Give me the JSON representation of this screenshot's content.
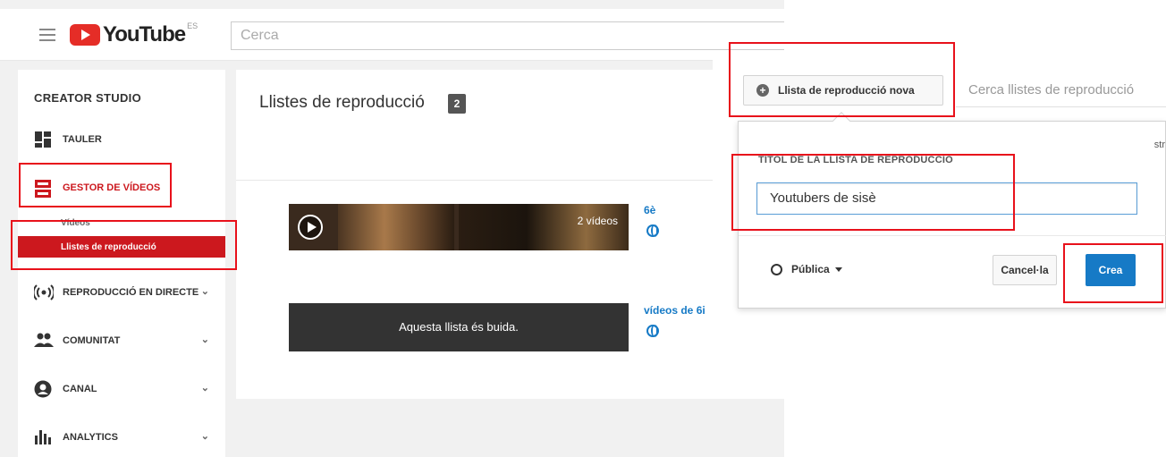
{
  "header": {
    "logo_text": "YouTube",
    "logo_region": "ES",
    "search_placeholder": "Cerca"
  },
  "sidebar": {
    "title": "CREATOR STUDIO",
    "items": [
      {
        "label": "TAULER",
        "icon": "dashboard-icon"
      },
      {
        "label": "GESTOR DE VÍDEOS",
        "icon": "video-manager-icon",
        "active": true
      },
      {
        "label": "REPRODUCCIÓ EN DIRECTE",
        "icon": "live-broadcast-icon"
      },
      {
        "label": "COMUNITAT",
        "icon": "community-icon"
      },
      {
        "label": "CANAL",
        "icon": "channel-icon"
      },
      {
        "label": "ANALYTICS",
        "icon": "analytics-icon"
      }
    ],
    "subitems": [
      {
        "label": "Vídeos"
      },
      {
        "label": "Llistes de reproducció",
        "active": true
      }
    ]
  },
  "main": {
    "title": "Llistes de reproducció",
    "count": "2",
    "playlists": [
      {
        "overlay": "2 vídeos",
        "meta": "6è"
      },
      {
        "empty_text": "Aquesta llista és buida.",
        "meta": "vídeos de 6i"
      }
    ]
  },
  "dialog": {
    "new_button": "Llista de reproducció nova",
    "search_placeholder": "Cerca llistes de reproducció",
    "cut_text": "str",
    "field_label": "TÍTOL DE LA LLISTA DE REPRODUCCIÓ",
    "field_value": "Youtubers de sisè",
    "privacy": "Pública",
    "cancel": "Cancel·la",
    "create": "Crea"
  },
  "colors": {
    "brand_red": "#cc181e",
    "link_blue": "#167ac6",
    "highlight_red": "#e8111b"
  }
}
